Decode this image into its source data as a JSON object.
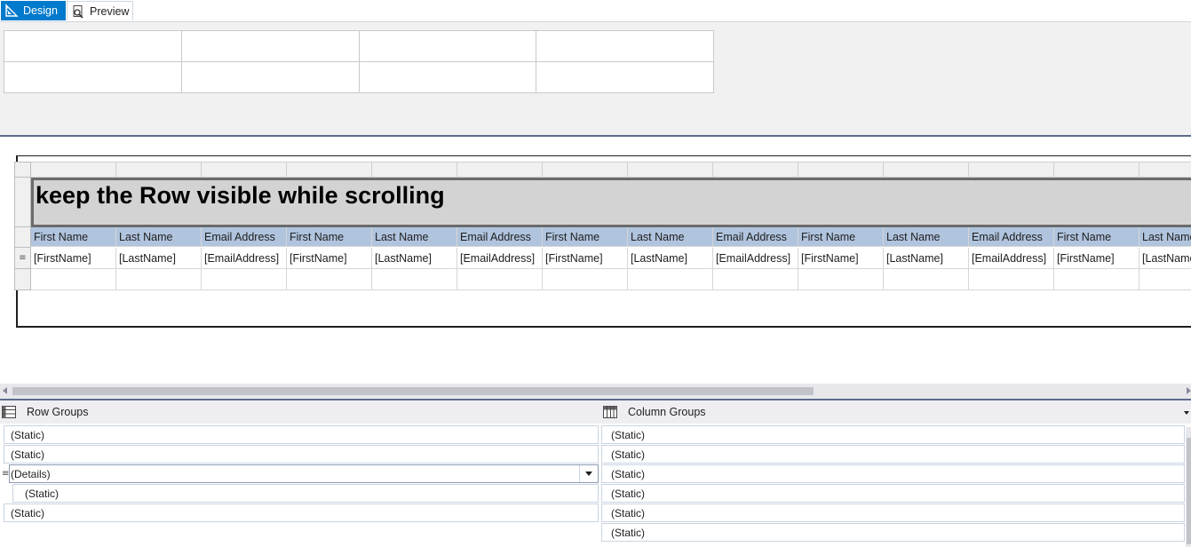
{
  "tabs": [
    {
      "label": "Design",
      "icon": "design-ruler-icon",
      "active": true
    },
    {
      "label": "Preview",
      "icon": "preview-icon",
      "active": false
    }
  ],
  "report": {
    "title": "keep the Row visible while scrolling",
    "header_row": [
      "First Name",
      "Last Name",
      "Email Address",
      "First Name",
      "Last Name",
      "Email Address",
      "First Name",
      "Last Name",
      "Email Address",
      "First Name",
      "Last Name",
      "Email Address",
      "First Name",
      "Last Name"
    ],
    "detail_row": [
      "[FirstName]",
      "[LastName]",
      "[EmailAddress]",
      "[FirstName]",
      "[LastName]",
      "[EmailAddress]",
      "[FirstName]",
      "[LastName]",
      "[EmailAddress]",
      "[FirstName]",
      "[LastName]",
      "[EmailAddress]",
      "[FirstName]",
      "[LastName]"
    ],
    "header_color": "#b0c4de",
    "title_bg": "#d3d3d3"
  },
  "row_groups": {
    "label": "Row Groups",
    "items": [
      "(Static)",
      "(Static)",
      "(Details)",
      "(Static)",
      "(Static)"
    ]
  },
  "column_groups": {
    "label": "Column Groups",
    "items": [
      "(Static)",
      "(Static)",
      "(Static)",
      "(Static)",
      "(Static)",
      "(Static)"
    ]
  },
  "colors": {
    "accent": "#007acc",
    "separator": "#5c6d8c"
  }
}
